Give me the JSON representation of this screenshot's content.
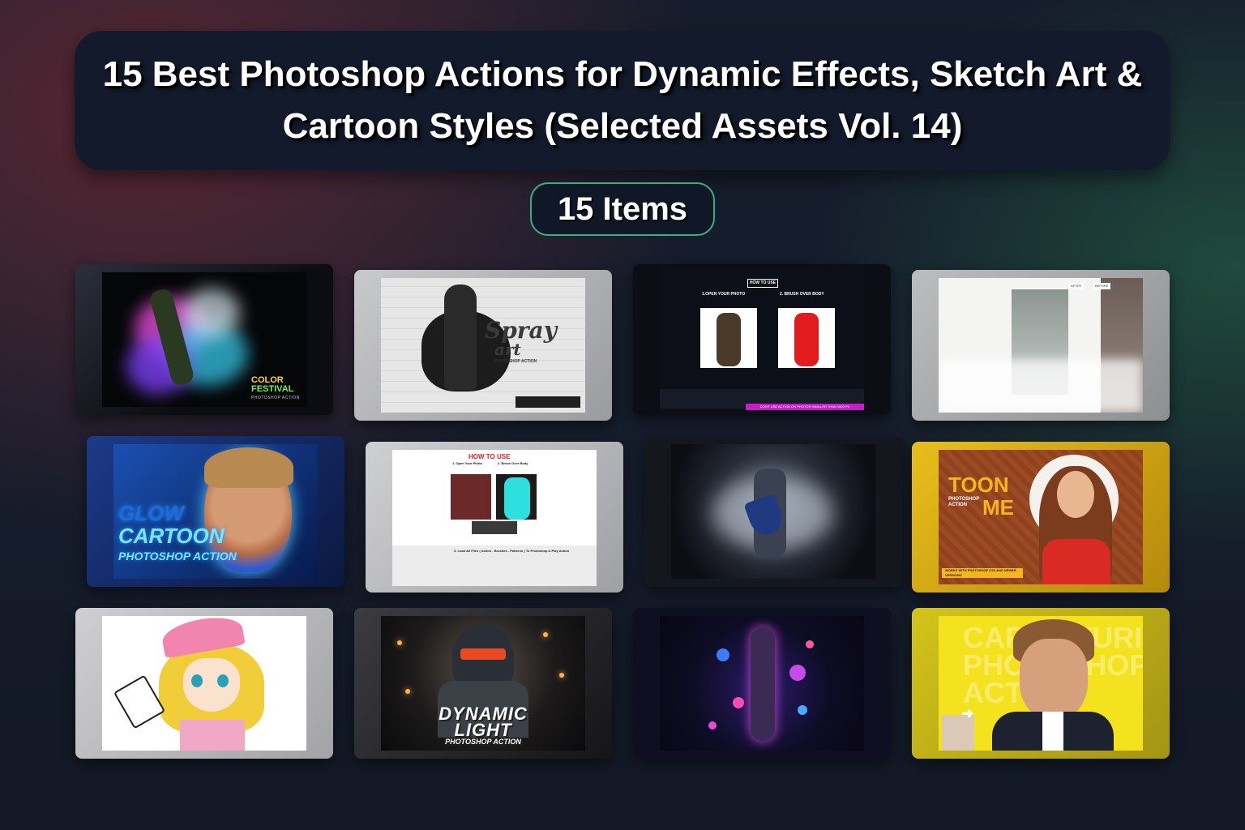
{
  "header": {
    "title": "15 Best Photoshop Actions for Dynamic Effects, Sketch Art & Cartoon Styles (Selected Assets Vol. 14)",
    "item_count": "15 Items"
  },
  "colors": {
    "title_box": "#121a2b",
    "pill_border": "#3fae7e",
    "bg_red": "#5a2530",
    "bg_green": "#1f4a3c"
  },
  "thumbnails": [
    {
      "id": "color-festival",
      "text": [
        "COLOR",
        "FESTIVAL",
        "PHOTOSHOP ACTION"
      ]
    },
    {
      "id": "spray-art",
      "text": [
        "Spray",
        "art",
        "PHOTOSHOP ACTION"
      ]
    },
    {
      "id": "brush-how-to-use",
      "text": [
        "HOW TO USE",
        "1.OPEN YOUR PHOTO",
        "2. BRUSH OVER BODY",
        "DON'T USE ACTION ON PHOTOS SMALLER THAN 1500 PX"
      ]
    },
    {
      "id": "sketch-building",
      "text": [
        "AFTER",
        "BEFORE"
      ]
    },
    {
      "id": "glow-cartoon",
      "text": [
        "GLOW",
        "CARTOON",
        "PHOTOSHOP ACTION"
      ]
    },
    {
      "id": "body-how-to-use",
      "text": [
        "HOW TO USE",
        "1. Open Your Photo",
        "2. Brush Over Body",
        "3. Load All Files ( Action - Brushes - Patterns ) To Photoshop & Play Action"
      ]
    },
    {
      "id": "knight-dust",
      "text": []
    },
    {
      "id": "toon-me",
      "text": [
        "TOON",
        "PHOTOSHOP ACTION",
        "ME",
        "WORKS WITH PHOTOSHOP CS3 AND NEWER VERSIONS"
      ]
    },
    {
      "id": "anime-sketch",
      "text": []
    },
    {
      "id": "dynamic-light",
      "text": [
        "DYNAMIC",
        "LIGHT",
        "PHOTOSHOP ACTION"
      ]
    },
    {
      "id": "neon-dancer",
      "text": []
    },
    {
      "id": "caricature",
      "text": [
        "CARICATURI",
        "PHOTOSHOP",
        "ACTION"
      ]
    }
  ]
}
